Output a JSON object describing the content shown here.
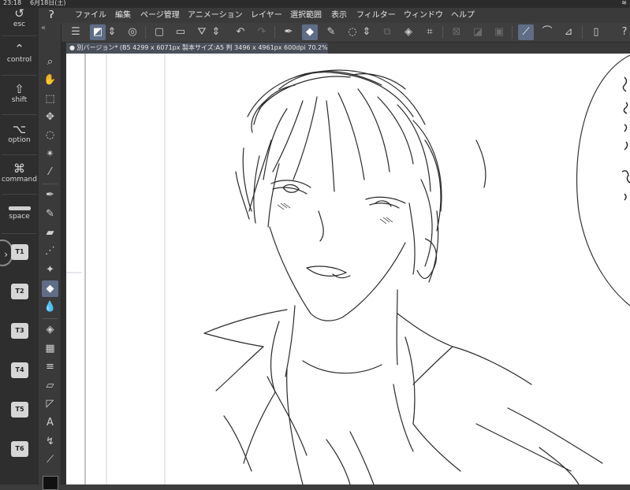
{
  "status_bar": {
    "time": "23:18",
    "date": "6月18日(土)",
    "wifi_icon": "wifi-icon"
  },
  "modifier_keys": [
    {
      "key": "esc",
      "label": "esc",
      "glyph": "↺"
    },
    {
      "key": "control",
      "label": "control",
      "glyph": "⌃"
    },
    {
      "key": "shift",
      "label": "shift",
      "glyph": "⇧"
    },
    {
      "key": "option",
      "label": "option",
      "glyph": "⌥"
    },
    {
      "key": "command",
      "label": "command",
      "glyph": "⌘"
    },
    {
      "key": "space",
      "label": "space"
    }
  ],
  "shortcut_buttons": [
    "T1",
    "T2",
    "T3",
    "T4",
    "T5",
    "T6"
  ],
  "menu_items": [
    "ファイル",
    "編集",
    "ページ管理",
    "アニメーション",
    "レイヤー",
    "選択範囲",
    "表示",
    "フィルター",
    "ウィンドウ",
    "ヘルプ"
  ],
  "document_tab": "● 別バージョン* (B5 4299 x 6071px 製本サイズ:A5 判 3496 x 4961px 600dpi 70.2%)",
  "command_bar": {
    "items": [
      "menu",
      "edit-mode",
      "stepper",
      "layer-property",
      "new-page",
      "open",
      "save",
      "stepper",
      "undo",
      "redo",
      "pen",
      "eraser",
      "marker",
      "select-all",
      "stepper",
      "copy",
      "fill",
      "transform",
      "clear-outside",
      "clear",
      "fill-selection",
      "vector-line",
      "snap-line",
      "ruler-snap",
      "reference",
      "help"
    ],
    "active": [
      "edit-mode",
      "eraser",
      "vector-line"
    ]
  },
  "tools": [
    "zoom",
    "hand",
    "operation",
    "move-layer",
    "lasso",
    "magic-wand",
    "eyedropper",
    "pen",
    "pencil",
    "brush",
    "airbrush",
    "decoration",
    "eraser",
    "blend",
    "fill",
    "gradient",
    "figure",
    "frame-border",
    "ruler",
    "text",
    "balloon",
    "correct-line"
  ],
  "active_tool": "eraser",
  "accent_color": "#5f6d86",
  "canvas_background": "#ffffff",
  "drawing_subject": "sketch"
}
